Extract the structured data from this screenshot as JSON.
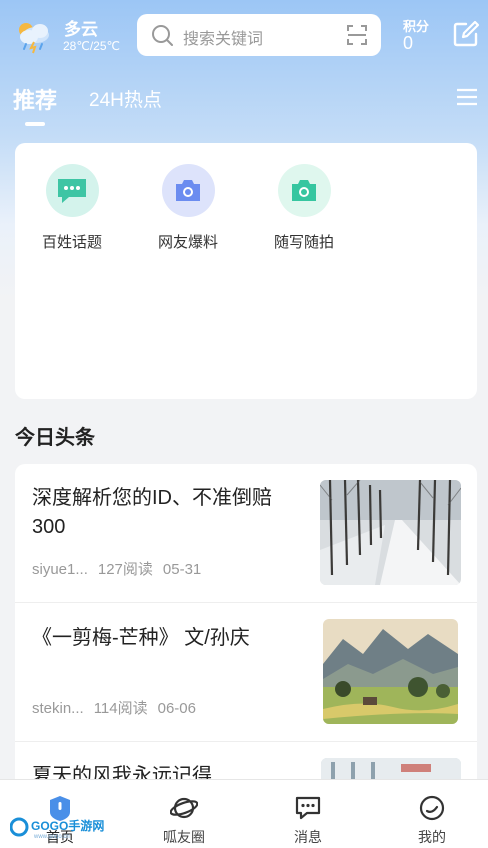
{
  "weather": {
    "condition": "多云",
    "temperature": "28℃/25℃",
    "icon": "cloudy-rain-icon"
  },
  "search": {
    "placeholder": "搜索关键词"
  },
  "points": {
    "label": "积分",
    "value": "0"
  },
  "tabs": [
    {
      "label": "推荐",
      "active": true
    },
    {
      "label": "24H热点",
      "active": false
    }
  ],
  "shortcuts": [
    {
      "label": "百姓话题",
      "icon": "chat-bubble-icon",
      "bg": "#d4f3ec",
      "color": "#3ec5a4"
    },
    {
      "label": "网友爆料",
      "icon": "camera-icon",
      "bg": "#dde3fb",
      "color": "#6b8cf0"
    },
    {
      "label": "随写随拍",
      "icon": "camera-icon",
      "bg": "#dff7ee",
      "color": "#36c6a0"
    }
  ],
  "section_title": "今日头条",
  "news": [
    {
      "title": "深度解析您的ID、不准倒赔300",
      "author": "siyue1...",
      "reads": "127阅读",
      "date": "05-31",
      "thumb": "snowy-tree-road"
    },
    {
      "title": "《一剪梅-芒种》 文/孙庆",
      "author": "stekin...",
      "reads": "114阅读",
      "date": "06-06",
      "thumb": "landscape-painting"
    },
    {
      "title": "夏天的风我永远记得",
      "author": "",
      "reads": "",
      "date": "",
      "thumb": "building"
    }
  ],
  "bottom_nav": [
    {
      "label": "首页",
      "icon": "home-icon",
      "active": true
    },
    {
      "label": "呱友圈",
      "icon": "planet-icon",
      "active": false
    },
    {
      "label": "消息",
      "icon": "message-icon",
      "active": false
    },
    {
      "label": "我的",
      "icon": "user-icon",
      "active": false
    }
  ],
  "watermark": {
    "text": "GOGO手游网",
    "sub": "www.gogo.cn"
  },
  "colors": {
    "accent": "#4a8fe8",
    "header_top": "#9cc6f5"
  }
}
